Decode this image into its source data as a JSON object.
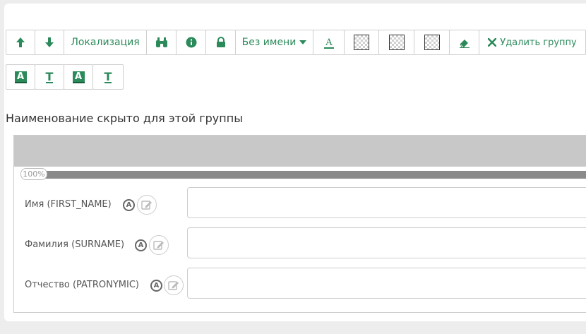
{
  "toolbar": {
    "localization_label": "Локализация",
    "name_select_label": "Без имени",
    "delete_group_label": "Удалить группу",
    "style_buttons": [
      "A",
      "T",
      "A",
      "T"
    ]
  },
  "group": {
    "hidden_notice": "Наименование скрыто для этой группы",
    "progress_value": 100,
    "progress_text": "100%",
    "fields": [
      {
        "label": "Имя (FIRST_NAME)",
        "badge": "A",
        "value": ""
      },
      {
        "label": "Фамилия (SURNAME)",
        "badge": "A",
        "value": ""
      },
      {
        "label": "Отчество (PATRONYMIC)",
        "badge": "A",
        "value": ""
      }
    ]
  },
  "colors": {
    "accent": "#2b8a5a",
    "header_bar": "#c8c8c8",
    "progress_fill": "#8a8a8a"
  },
  "icons": [
    "arrow-up-icon",
    "arrow-down-icon",
    "binoculars-icon",
    "info-icon",
    "lock-icon",
    "caret-down-icon",
    "text-color-icon",
    "checker-icon",
    "eraser-icon",
    "close-icon",
    "pencil-square-icon"
  ]
}
